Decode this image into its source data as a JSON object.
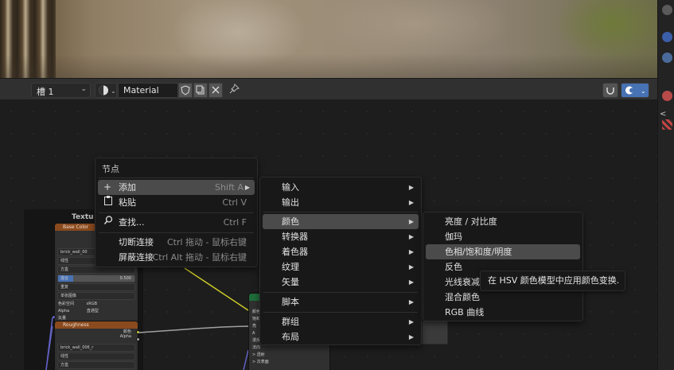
{
  "header": {
    "slot_label": "槽 1",
    "material_name": "Material"
  },
  "node_frame": {
    "title": "Textu",
    "node1": {
      "title": "Base Color",
      "image": "brick_wall_00",
      "rows": [
        "线性",
        "方盒",
        "混合",
        "重复",
        "单张图像",
        "色彩空间",
        "Alpha",
        "矢量"
      ],
      "mix_value": "0.500",
      "color_space": "sRGB",
      "alpha_mode": "直通型"
    },
    "node2": {
      "title": "Roughness",
      "image": "brick_wall_006_r",
      "rows": [
        "线性",
        "方盒"
      ],
      "out_color": "颜色",
      "out_alpha": "Alpha"
    },
    "node3_rows": [
      "颜色",
      "ã",
      "饱和",
      "亮",
      "A",
      "漫反",
      "法向",
      "> 透射",
      "> 次表面"
    ]
  },
  "context_menu": {
    "title": "节点",
    "items": [
      {
        "label": "添加",
        "shortcut": "Shift A",
        "icon": "+",
        "highlighted": true,
        "submenu": true
      },
      {
        "label": "粘贴",
        "shortcut": "Ctrl V",
        "icon": "📋"
      },
      {
        "label": "查找...",
        "shortcut": "Ctrl F",
        "icon": "🔍"
      },
      {
        "label": "切断连接",
        "shortcut": "Ctrl 拖动 - 鼠标右键"
      },
      {
        "label": "屏蔽连接",
        "shortcut": "Ctrl Alt 拖动 - 鼠标右键"
      }
    ]
  },
  "add_menu": {
    "items": [
      "输入",
      "输出",
      "颜色",
      "转换器",
      "着色器",
      "纹理",
      "矢量",
      "脚本",
      "群组",
      "布局"
    ],
    "highlighted": "颜色"
  },
  "color_menu": {
    "items": [
      "亮度 / 对比度",
      "伽玛",
      "色相/饱和度/明度",
      "反色",
      "光线衰减",
      "混合颜色",
      "RGB 曲线"
    ],
    "highlighted": "色相/饱和度/明度"
  },
  "tooltip": {
    "text": "在 HSV 颜色模型中应用颜色变换."
  },
  "colors": {
    "accent": "#4772b3",
    "menu_bg": "#181818",
    "highlight": "#4b4b4b",
    "node_header": "#8a4a1e"
  }
}
